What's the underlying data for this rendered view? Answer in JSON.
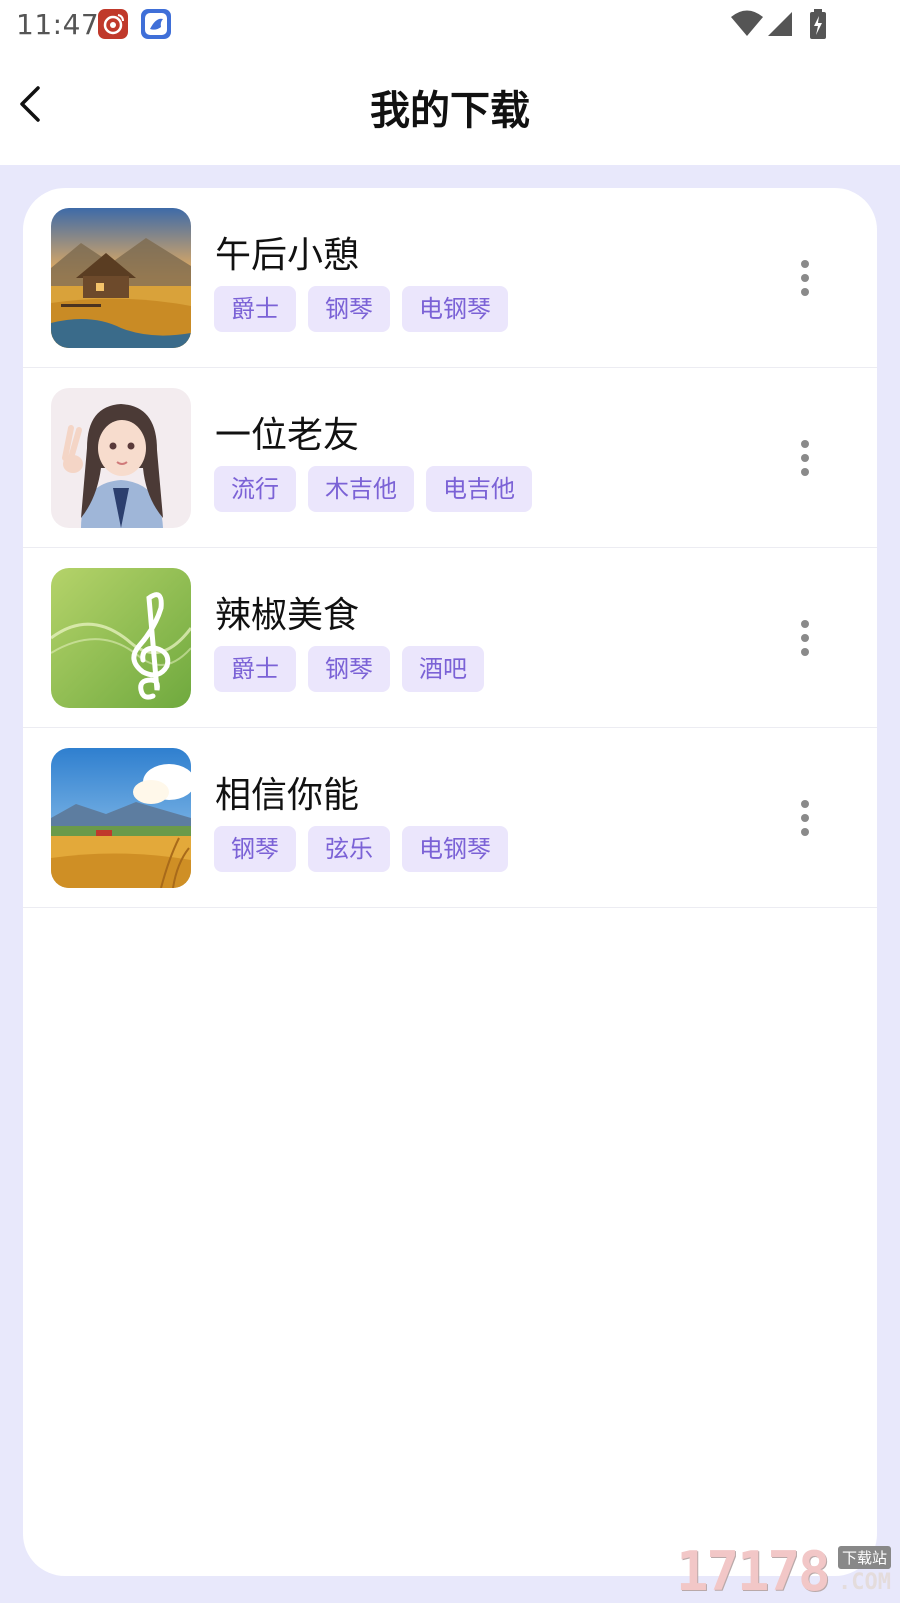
{
  "status_bar": {
    "time": "11:47",
    "notification_icons": [
      "weibo-icon",
      "app-bird-icon"
    ],
    "indicators": [
      "wifi-icon",
      "signal-icon",
      "battery-charging-icon"
    ]
  },
  "header": {
    "back_icon": "chevron-left-icon",
    "title": "我的下载"
  },
  "downloads": [
    {
      "title": "午后小憩",
      "cover": "farmhouse-landscape-image",
      "tags": [
        "爵士",
        "钢琴",
        "电钢琴"
      ]
    },
    {
      "title": "一位老友",
      "cover": "girl-portrait-image",
      "tags": [
        "流行",
        "木吉他",
        "电吉他"
      ]
    },
    {
      "title": "辣椒美食",
      "cover": "treble-clef-image",
      "tags": [
        "爵士",
        "钢琴",
        "酒吧"
      ]
    },
    {
      "title": "相信你能",
      "cover": "wheat-field-landscape-image",
      "tags": [
        "钢琴",
        "弦乐",
        "电钢琴"
      ]
    }
  ],
  "watermark": {
    "main": "17178",
    "badge": "下载站",
    "suffix": ".COM"
  },
  "colors": {
    "page_background": "#e8e8fb",
    "tag_background": "#ebe6fc",
    "tag_text": "#7b62d6",
    "more_dots": "#8a8a8a"
  }
}
